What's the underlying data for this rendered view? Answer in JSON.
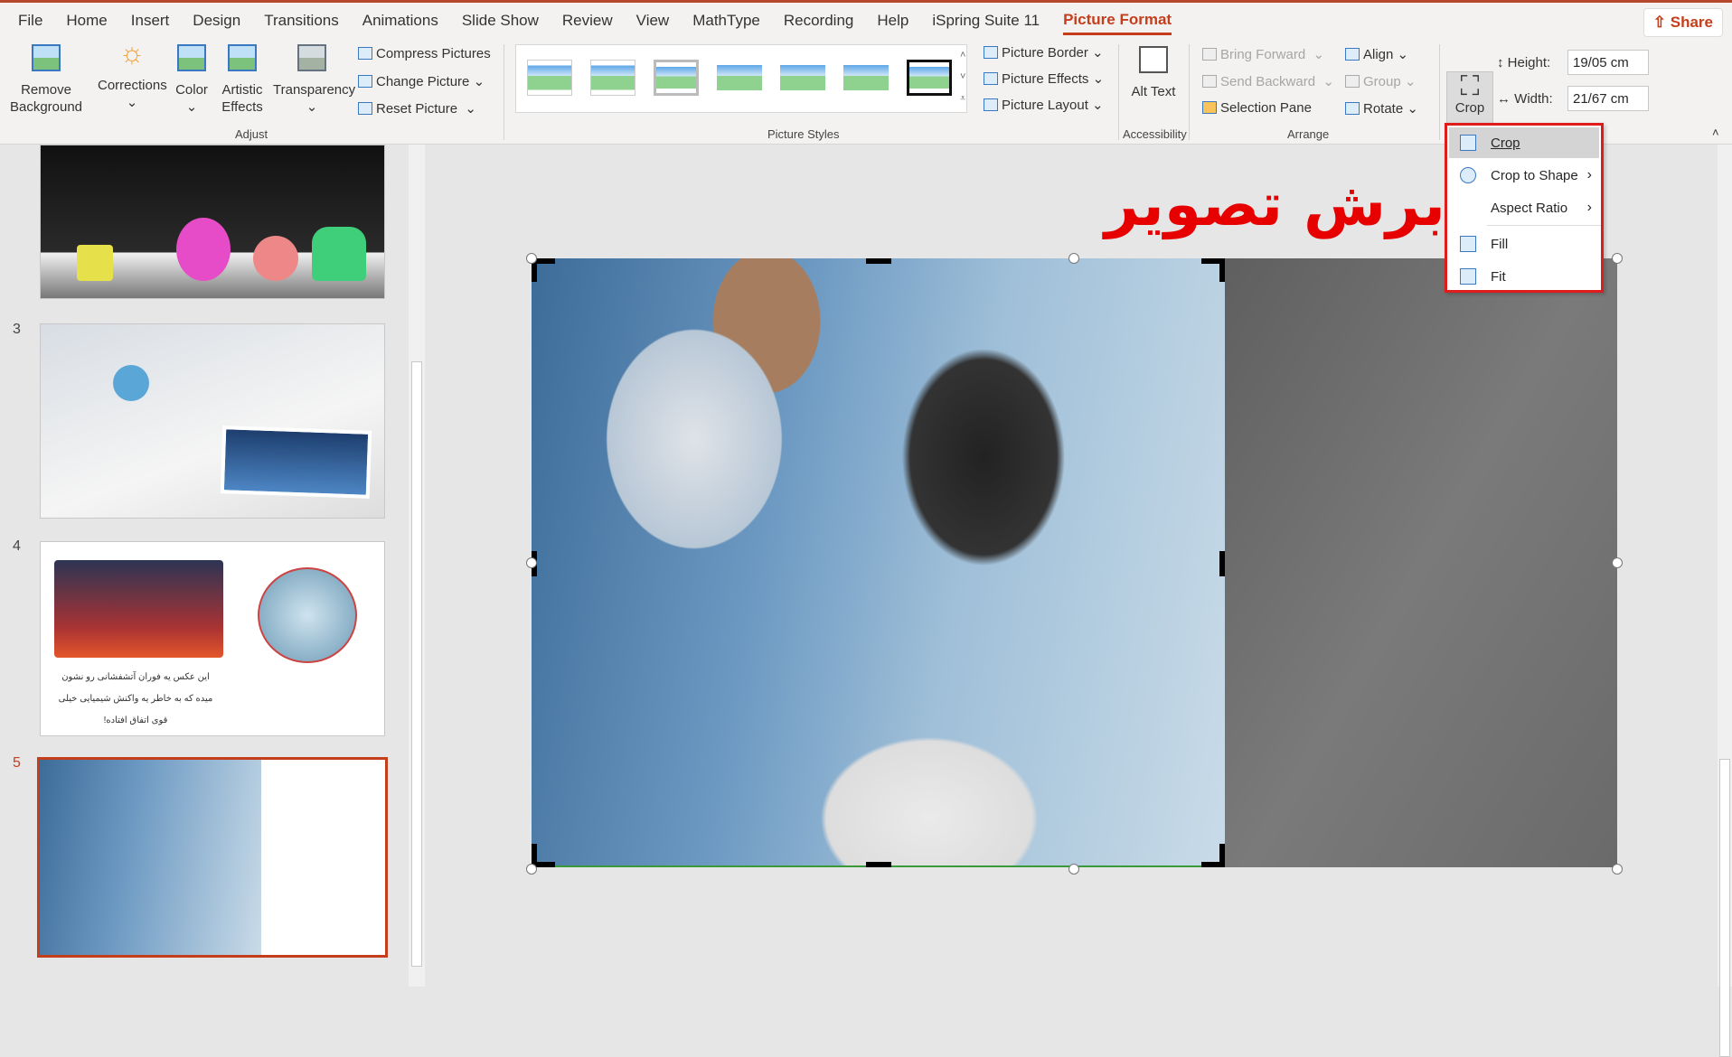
{
  "tabs": [
    "File",
    "Home",
    "Insert",
    "Design",
    "Transitions",
    "Animations",
    "Slide Show",
    "Review",
    "View",
    "MathType",
    "Recording",
    "Help",
    "iSpring Suite 11",
    "Picture Format"
  ],
  "active_tab": "Picture Format",
  "share_label": "Share",
  "ribbon": {
    "adjust": {
      "remove_background": "Remove Background",
      "corrections": "Corrections",
      "color": "Color",
      "artistic_effects": "Artistic Effects",
      "transparency": "Transparency",
      "compress": "Compress Pictures",
      "change": "Change Picture",
      "reset": "Reset Picture",
      "group_label": "Adjust"
    },
    "styles": {
      "border": "Picture Border",
      "effects": "Picture Effects",
      "layout": "Picture Layout",
      "group_label": "Picture Styles"
    },
    "accessibility": {
      "alt_text": "Alt Text",
      "group_label": "Accessibility"
    },
    "arrange": {
      "bring_forward": "Bring Forward",
      "send_backward": "Send Backward",
      "selection_pane": "Selection Pane",
      "align": "Align",
      "group": "Group",
      "rotate": "Rotate",
      "group_label": "Arrange"
    },
    "size": {
      "crop": "Crop",
      "height_label": "Height:",
      "height_value": "19/05 cm",
      "width_label": "Width:",
      "width_value": "21/67 cm"
    }
  },
  "crop_menu": {
    "items": [
      {
        "label": "Crop",
        "icon": "crop-icon"
      },
      {
        "label": "Crop to Shape",
        "icon": "crop-to-shape-icon",
        "submenu": true
      },
      {
        "label": "Aspect Ratio",
        "submenu": true
      },
      {
        "label": "Fill",
        "icon": "fill-icon"
      },
      {
        "label": "Fit",
        "icon": "fit-icon"
      }
    ]
  },
  "slides": [
    {
      "number": "3"
    },
    {
      "number": "4",
      "caption": "این عکس یه فوران آتشفشانی رو نشون میده که به خاطر یه واکنش شیمیایی خیلی قوی اتفاق افتاده!"
    },
    {
      "number": "5",
      "selected": true
    }
  ],
  "slide": {
    "title": "برش تصویر"
  },
  "colors": {
    "accent": "#c43e1c",
    "title": "#e60000",
    "menu_highlight": "#e01b1b"
  }
}
